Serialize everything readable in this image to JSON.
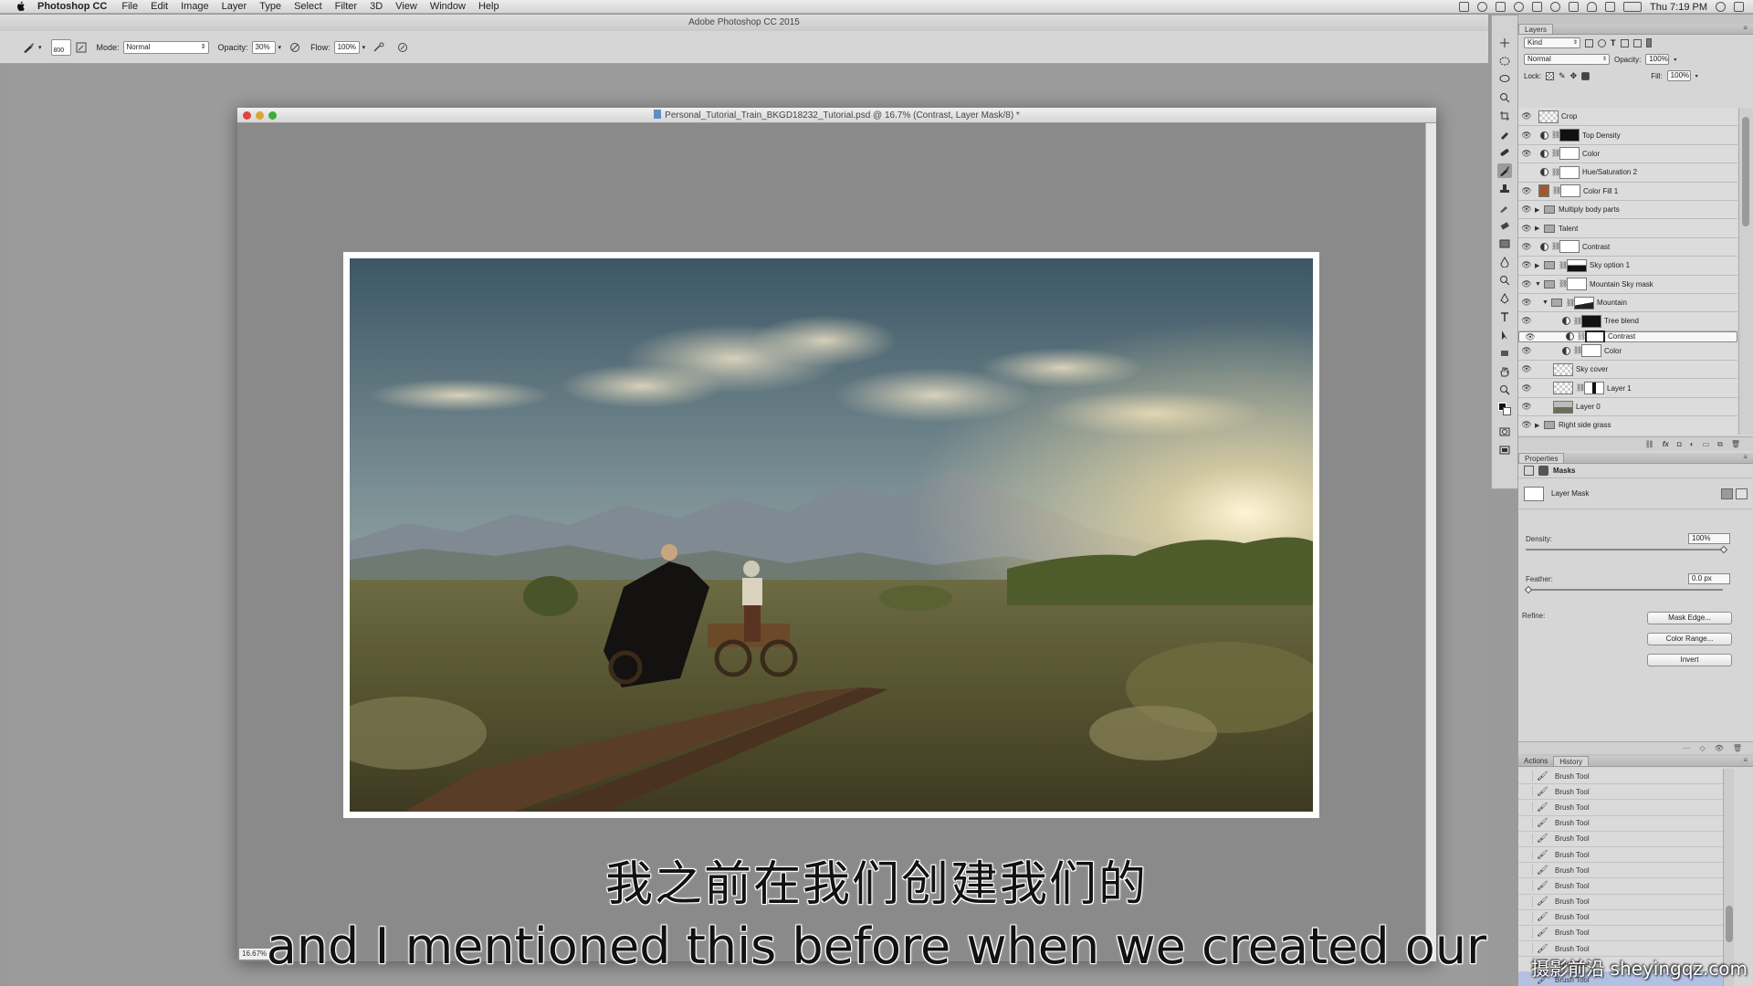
{
  "menubar": {
    "app_name": "Photoshop CC",
    "items": [
      "File",
      "Edit",
      "Image",
      "Layer",
      "Type",
      "Select",
      "Filter",
      "3D",
      "View",
      "Window",
      "Help"
    ],
    "clock": "Thu 7:19 PM"
  },
  "window_title": "Adobe Photoshop CC 2015",
  "options_bar": {
    "brush_size": "800",
    "mode_label": "Mode:",
    "mode_value": "Normal",
    "opacity_label": "Opacity:",
    "opacity_value": "30%",
    "flow_label": "Flow:",
    "flow_value": "100%"
  },
  "document": {
    "title": "Personal_Tutorial_Train_BKGD18232_Tutorial.psd @ 16.7% (Contrast, Layer Mask/8) *",
    "zoom": "16.67%"
  },
  "layers_panel": {
    "tab": "Layers",
    "filter_kind": "Kind",
    "blend_mode": "Normal",
    "opacity_label": "Opacity:",
    "opacity_value": "100%",
    "lock_label": "Lock:",
    "fill_label": "Fill:",
    "fill_value": "100%",
    "layers": [
      {
        "name": "Crop"
      },
      {
        "name": "Top Density"
      },
      {
        "name": "Color"
      },
      {
        "name": "Hue/Saturation 2"
      },
      {
        "name": "Color Fill 1"
      },
      {
        "name": "Multiply body parts"
      },
      {
        "name": "Talent"
      },
      {
        "name": "Contrast"
      },
      {
        "name": "Sky option 1"
      },
      {
        "name": "Mountain Sky mask"
      },
      {
        "name": "Mountain"
      },
      {
        "name": "Tree blend"
      },
      {
        "name": "Contrast"
      },
      {
        "name": "Color"
      },
      {
        "name": "Sky cover"
      },
      {
        "name": "Layer 1"
      },
      {
        "name": "Layer 0"
      },
      {
        "name": "Right side grass"
      }
    ]
  },
  "properties_panel": {
    "tab": "Properties",
    "section": "Masks",
    "mask_label": "Layer Mask",
    "density_label": "Density:",
    "density_value": "100%",
    "feather_label": "Feather:",
    "feather_value": "0.0 px",
    "refine_label": "Refine:",
    "btn_mask_edge": "Mask Edge...",
    "btn_color_range": "Color Range...",
    "btn_invert": "Invert"
  },
  "history_panel": {
    "tabs": [
      "Actions",
      "History"
    ],
    "items": [
      "Brush Tool",
      "Brush Tool",
      "Brush Tool",
      "Brush Tool",
      "Brush Tool",
      "Brush Tool",
      "Brush Tool",
      "Brush Tool",
      "Brush Tool",
      "Brush Tool",
      "Brush Tool",
      "Brush Tool",
      "Brush Tool",
      "Brush Tool"
    ]
  },
  "subtitles": {
    "chinese": "我之前在我们创建我们的",
    "english": "and I mentioned this before when we created our"
  },
  "watermark": "摄影前沿 sheyingqz.com",
  "colors": {
    "selection": "#b2c1e3",
    "brown_fill": "#9c5b2e"
  }
}
